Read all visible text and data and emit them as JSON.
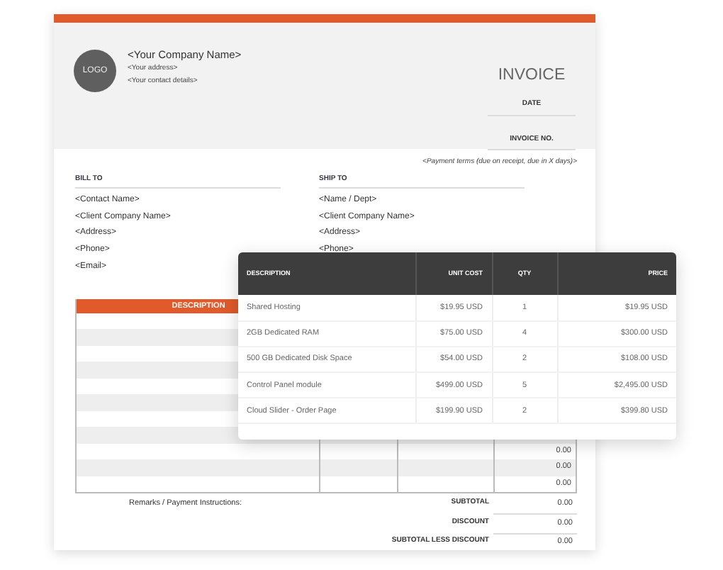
{
  "invoice": {
    "logo": "LOGO",
    "company_name": "<Your Company Name>",
    "address": "<Your address>",
    "contact": "<Your contact details>",
    "title": "INVOICE",
    "meta_fields": [
      "DATE",
      "INVOICE NO."
    ],
    "payment_terms": "<Payment terms (due on receipt, due in X days)>",
    "bill_to": {
      "label": "BILL TO",
      "lines": [
        "<Contact Name>",
        "<Client Company Name>",
        "<Address>",
        "<Phone>",
        "<Email>"
      ]
    },
    "ship_to": {
      "label": "SHIP TO",
      "lines": [
        "<Name / Dept>",
        "<Client Company Name>",
        "<Address>",
        "<Phone>"
      ]
    },
    "items_table": {
      "columns": [
        "DESCRIPTION"
      ],
      "visible_amounts": [
        "0.00",
        "0.00",
        "0.00"
      ]
    },
    "remarks": "Remarks / Payment Instructions:",
    "totals": [
      {
        "label": "SUBTOTAL",
        "value": "0.00"
      },
      {
        "label": "DISCOUNT",
        "value": "0.00"
      },
      {
        "label": "SUBTOTAL LESS DISCOUNT",
        "value": "0.00"
      }
    ]
  },
  "order_table": {
    "columns": [
      "DESCRIPTION",
      "UNIT COST",
      "QTY",
      "PRICE"
    ],
    "rows": [
      [
        "Shared Hosting",
        "$19.95 USD",
        "1",
        "$19.95 USD"
      ],
      [
        "2GB Dedicated RAM",
        "$75.00 USD",
        "4",
        "$300.00 USD"
      ],
      [
        "500 GB Dedicated Disk Space",
        "$54.00 USD",
        "2",
        "$108.00 USD"
      ],
      [
        "Control Panel module",
        "$499.00 USD",
        "5",
        "$2,495.00 USD"
      ],
      [
        "Cloud Slider - Order Page",
        "$199.90 USD",
        "2",
        "$399.80 USD"
      ]
    ]
  }
}
